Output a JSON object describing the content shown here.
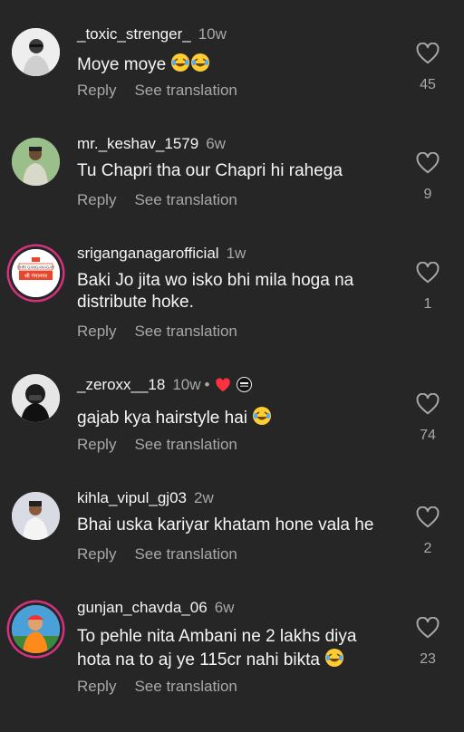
{
  "actions": {
    "reply": "Reply",
    "see_translation": "See translation"
  },
  "comments": [
    {
      "username": "_toxic_strenger_",
      "time": "10w",
      "text": "Moye moye",
      "likes": "45"
    },
    {
      "username": "mr._keshav_1579",
      "time": "6w",
      "text": "Tu Chapri tha our Chapri hi rahega",
      "likes": "9"
    },
    {
      "username": "sriganganagarofficial",
      "time": "1w",
      "text": "Baki Jo jita wo isko bhi mila hoga na distribute hoke.",
      "likes": "1",
      "avatar_text": "SHRI GANGANAGAR",
      "avatar_text_2": "श्री गंगानगर"
    },
    {
      "username": "_zeroxx__18",
      "time": "10w",
      "text": "gajab kya hairstyle hai",
      "likes": "74"
    },
    {
      "username": "kihla_vipul_gj03",
      "time": "2w",
      "text": "Bhai uska kariyar khatam hone vala he",
      "likes": "2"
    },
    {
      "username": "gunjan_chavda_06",
      "time": "6w",
      "text": "To pehle nita Ambani ne 2 lakhs diya hota na to aj ye 115cr nahi bikta",
      "likes": "23"
    }
  ],
  "colors": {
    "background": "#262626",
    "secondary_text": "#a8a8a8",
    "story_ring": "#d7317d",
    "heart_red": "#ff3040"
  }
}
